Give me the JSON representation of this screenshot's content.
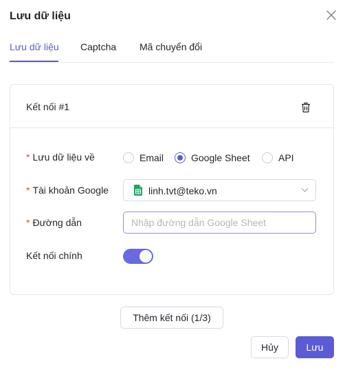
{
  "modal": {
    "title": "Lưu dữ liệu",
    "close_icon": "close-icon"
  },
  "tabs": [
    {
      "label": "Lưu dữ liệu",
      "active": true
    },
    {
      "label": "Captcha",
      "active": false
    },
    {
      "label": "Mã chuyển đổi",
      "active": false
    }
  ],
  "connection": {
    "title": "Kết nối #1",
    "delete_icon": "trash-icon",
    "save_to": {
      "label": "Lưu dữ liệu về",
      "required": true,
      "options": [
        "Email",
        "Google Sheet",
        "API"
      ],
      "selected": "Google Sheet"
    },
    "google_account": {
      "label": "Tài khoản Google",
      "required": true,
      "value": "linh.tvt@teko.vn",
      "icon": "google-sheets-icon"
    },
    "path": {
      "label": "Đường dẫn",
      "required": true,
      "value": "",
      "placeholder": "Nhập đường dẫn Google Sheet"
    },
    "primary": {
      "label": "Kết nối chính",
      "enabled": true
    }
  },
  "actions": {
    "add_connection": "Thêm kết nối (1/3)",
    "cancel": "Hủy",
    "save": "Lưu"
  },
  "colors": {
    "accent": "#5b5bd6",
    "required": "#f03e3e",
    "sheets_green": "#1fa463"
  }
}
